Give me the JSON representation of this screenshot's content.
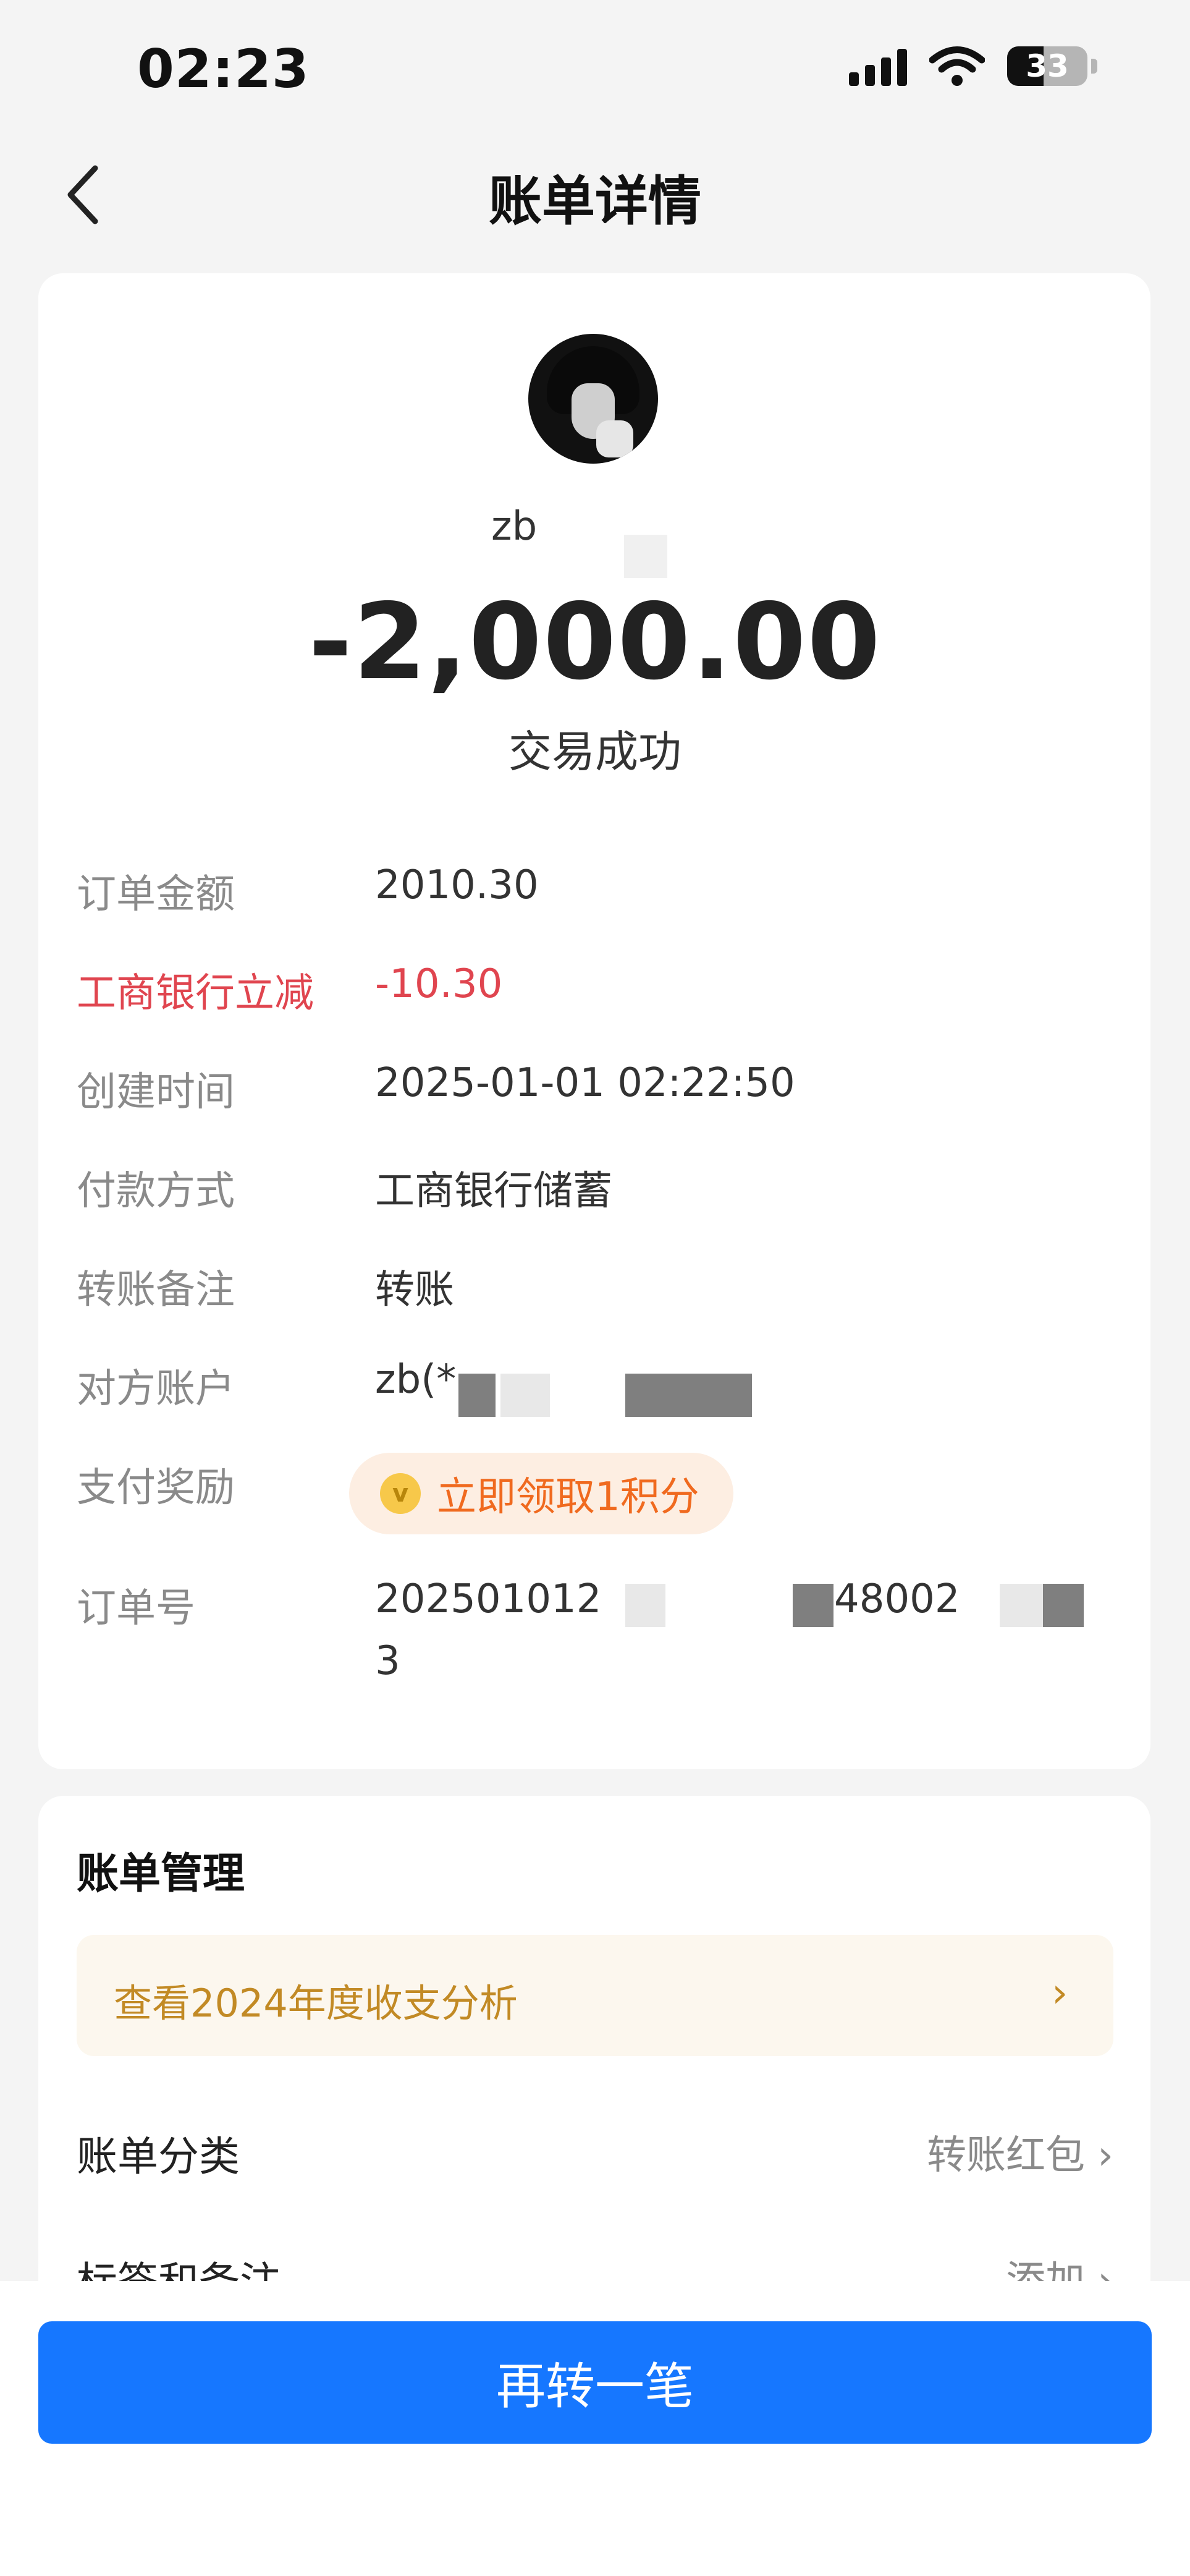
{
  "status_bar": {
    "time": "02:23",
    "battery": "33"
  },
  "nav": {
    "title": "账单详情"
  },
  "header": {
    "payee": "zb",
    "amount": "-2,000.00",
    "status": "交易成功"
  },
  "details": {
    "order_amount": {
      "label": "订单金额",
      "value": "2010.30"
    },
    "discount": {
      "label": "工商银行立减",
      "value": "-10.30"
    },
    "created": {
      "label": "创建时间",
      "value": "2025-01-01 02:22:50"
    },
    "payment": {
      "label": "付款方式",
      "value": "工商银行储蓄"
    },
    "remark": {
      "label": "转账备注",
      "value": "转账"
    },
    "account": {
      "label": "对方账户",
      "value": "zb(*"
    },
    "reward": {
      "label": "支付奖励",
      "value": "立即领取1积分"
    },
    "order_no": {
      "label": "订单号",
      "value_a": "202501012",
      "value_b": "48002",
      "value_c": "3"
    }
  },
  "management": {
    "title": "账单管理",
    "analysis": "查看2024年度收支分析",
    "category": {
      "label": "账单分类",
      "value": "转账红包"
    },
    "tags": {
      "label": "标签和备注",
      "value": "添加"
    }
  },
  "cta": {
    "label": "再转一笔"
  },
  "icons": {
    "back": "chevron-left-icon",
    "coin": "points-coin-icon",
    "chevron": "chevron-right-icon"
  },
  "colors": {
    "primary": "#1677ff",
    "discount": "#e0454f",
    "reward": "#f06a1f",
    "analysis": "#c28a25"
  }
}
